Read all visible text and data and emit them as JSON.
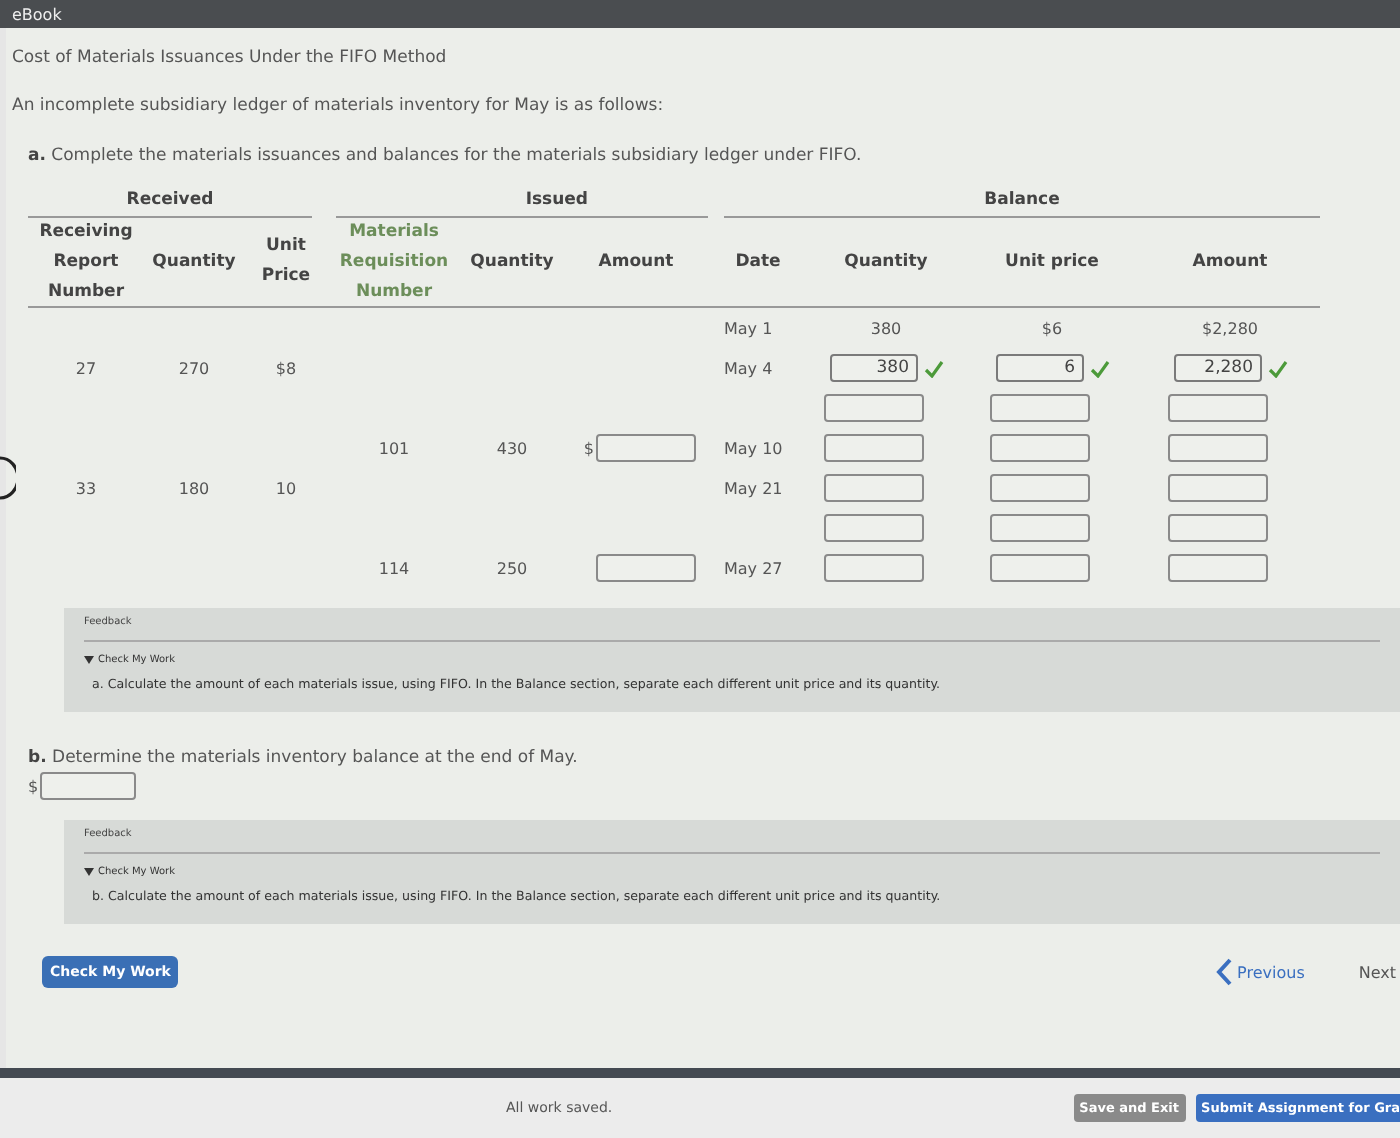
{
  "top_bar": {
    "title": "eBook"
  },
  "title": "Cost of Materials Issuances Under the FIFO Method",
  "intro": "An incomplete subsidiary ledger of materials inventory for May is as follows:",
  "part_a": {
    "letter": "a.",
    "prompt": "Complete the materials issuances and balances for the materials subsidiary ledger under FIFO."
  },
  "ledger": {
    "groups": [
      "Received",
      "Issued",
      "Balance"
    ],
    "columns": [
      "Receiving Report Number",
      "Quantity",
      "Unit Price",
      "Materials Requisition Number",
      "Quantity",
      "Amount",
      "Date",
      "Quantity",
      "Unit price",
      "Amount"
    ],
    "rows": [
      {
        "balance": {
          "date": "May 1",
          "cells": [
            {
              "kind": "text",
              "value": "380"
            },
            {
              "kind": "text",
              "value": "$6"
            },
            {
              "kind": "text",
              "value": "$2,280"
            }
          ]
        }
      },
      {
        "received": [
          "27",
          "270",
          "$8"
        ],
        "balance": {
          "date": "May 4",
          "cells": [
            {
              "kind": "field",
              "value": "380",
              "correct": true
            },
            {
              "kind": "field",
              "value": "6",
              "correct": true
            },
            {
              "kind": "field",
              "value": "2,280",
              "correct": true
            }
          ]
        }
      },
      {
        "balance": {
          "cells": [
            {
              "kind": "field",
              "correct": false
            },
            {
              "kind": "field",
              "correct": false
            },
            {
              "kind": "field",
              "correct": false
            }
          ]
        }
      },
      {
        "issued": {
          "number": "101",
          "quantity": "430",
          "amount_prefix": "$"
        },
        "balance": {
          "date": "May 10",
          "cells": [
            {
              "kind": "field",
              "correct": false
            },
            {
              "kind": "field",
              "correct": false
            },
            {
              "kind": "field",
              "correct": false
            }
          ]
        }
      },
      {
        "received": [
          "33",
          "180",
          "10"
        ],
        "balance": {
          "date": "May 21",
          "cells": [
            {
              "kind": "field",
              "correct": false
            },
            {
              "kind": "field",
              "correct": false
            },
            {
              "kind": "field",
              "correct": false
            }
          ]
        }
      },
      {
        "balance": {
          "cells": [
            {
              "kind": "field",
              "correct": false
            },
            {
              "kind": "field",
              "correct": false
            },
            {
              "kind": "field",
              "correct": false
            }
          ]
        }
      },
      {
        "issued": {
          "number": "114",
          "quantity": "250"
        },
        "balance": {
          "date": "May 27",
          "cells": [
            {
              "kind": "field",
              "correct": false
            },
            {
              "kind": "field",
              "correct": false
            },
            {
              "kind": "field",
              "correct": false
            }
          ]
        }
      }
    ]
  },
  "feedback_a": {
    "label": "Feedback",
    "toggle": "Check My Work",
    "text": "a. Calculate the amount of each materials issue, using FIFO. In the Balance section, separate each different unit price and its quantity."
  },
  "part_b": {
    "letter": "b.",
    "prompt": "Determine the materials inventory balance at the end of May.",
    "prefix": "$"
  },
  "feedback_b": {
    "label": "Feedback",
    "toggle": "Check My Work",
    "text": "b. Calculate the amount of each materials issue, using FIFO. In the Balance section, separate each different unit price and its quantity."
  },
  "check_button": "Check My Work",
  "nav": {
    "previous": "Previous",
    "next": "Next"
  },
  "footer": {
    "status": "All work saved.",
    "save_button": "Save and Exit",
    "submit_button": "Submit Assignment for Gra"
  }
}
